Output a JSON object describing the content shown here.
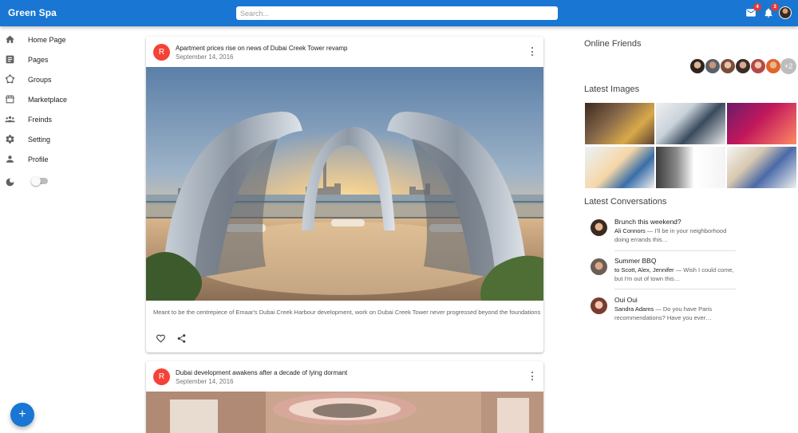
{
  "app": {
    "brand": "Green Spa"
  },
  "search": {
    "placeholder": "Search..."
  },
  "topbar": {
    "mail_badge": "4",
    "notifications_badge": "3"
  },
  "sidebar": {
    "items": [
      {
        "label": "Home Page",
        "icon": "home-icon"
      },
      {
        "label": "Pages",
        "icon": "article-icon"
      },
      {
        "label": "Groups",
        "icon": "groups-icon"
      },
      {
        "label": "Marketplace",
        "icon": "storefront-icon"
      },
      {
        "label": "Freinds",
        "icon": "people-icon"
      },
      {
        "label": "Setting",
        "icon": "gear-icon"
      },
      {
        "label": "Profile",
        "icon": "person-icon"
      }
    ],
    "dark_mode_icon": "moon-icon",
    "dark_mode_on": false,
    "fab_label": "+"
  },
  "feed": {
    "posts": [
      {
        "avatar_letter": "R",
        "title": "Apartment prices rise on news of Dubai Creek Tower revamp",
        "date": "September 14, 2016",
        "text": "Meant to be the centrepiece of Emaar's Dubai Creek Harbour development, work on Dubai Creek Tower never progressed beyond the foundations"
      },
      {
        "avatar_letter": "R",
        "title": "Dubai development awakens after a decade of lying dormant",
        "date": "September 14, 2016"
      }
    ]
  },
  "right": {
    "online_friends_heading": "Online Friends",
    "online_friends_more": "+2",
    "latest_images_heading": "Latest Images",
    "latest_conversations_heading": "Latest Conversations",
    "conversations": [
      {
        "title": "Brunch this weekend?",
        "sender": "Ali Connors",
        "message": " — I'll be in your neighborhood doing errands this…"
      },
      {
        "title": "Summer BBQ",
        "sender": "to Scott, Alex, Jennifer",
        "message": " — Wish I could come, but I'm out of town this…"
      },
      {
        "title": "Oui Oui",
        "sender": "Sandra Adams",
        "message": " — Do you have Paris recommendations? Have you ever…"
      }
    ]
  },
  "colors": {
    "primary": "#1976d2",
    "badge": "#e53935",
    "post_avatar": "#f44336"
  }
}
